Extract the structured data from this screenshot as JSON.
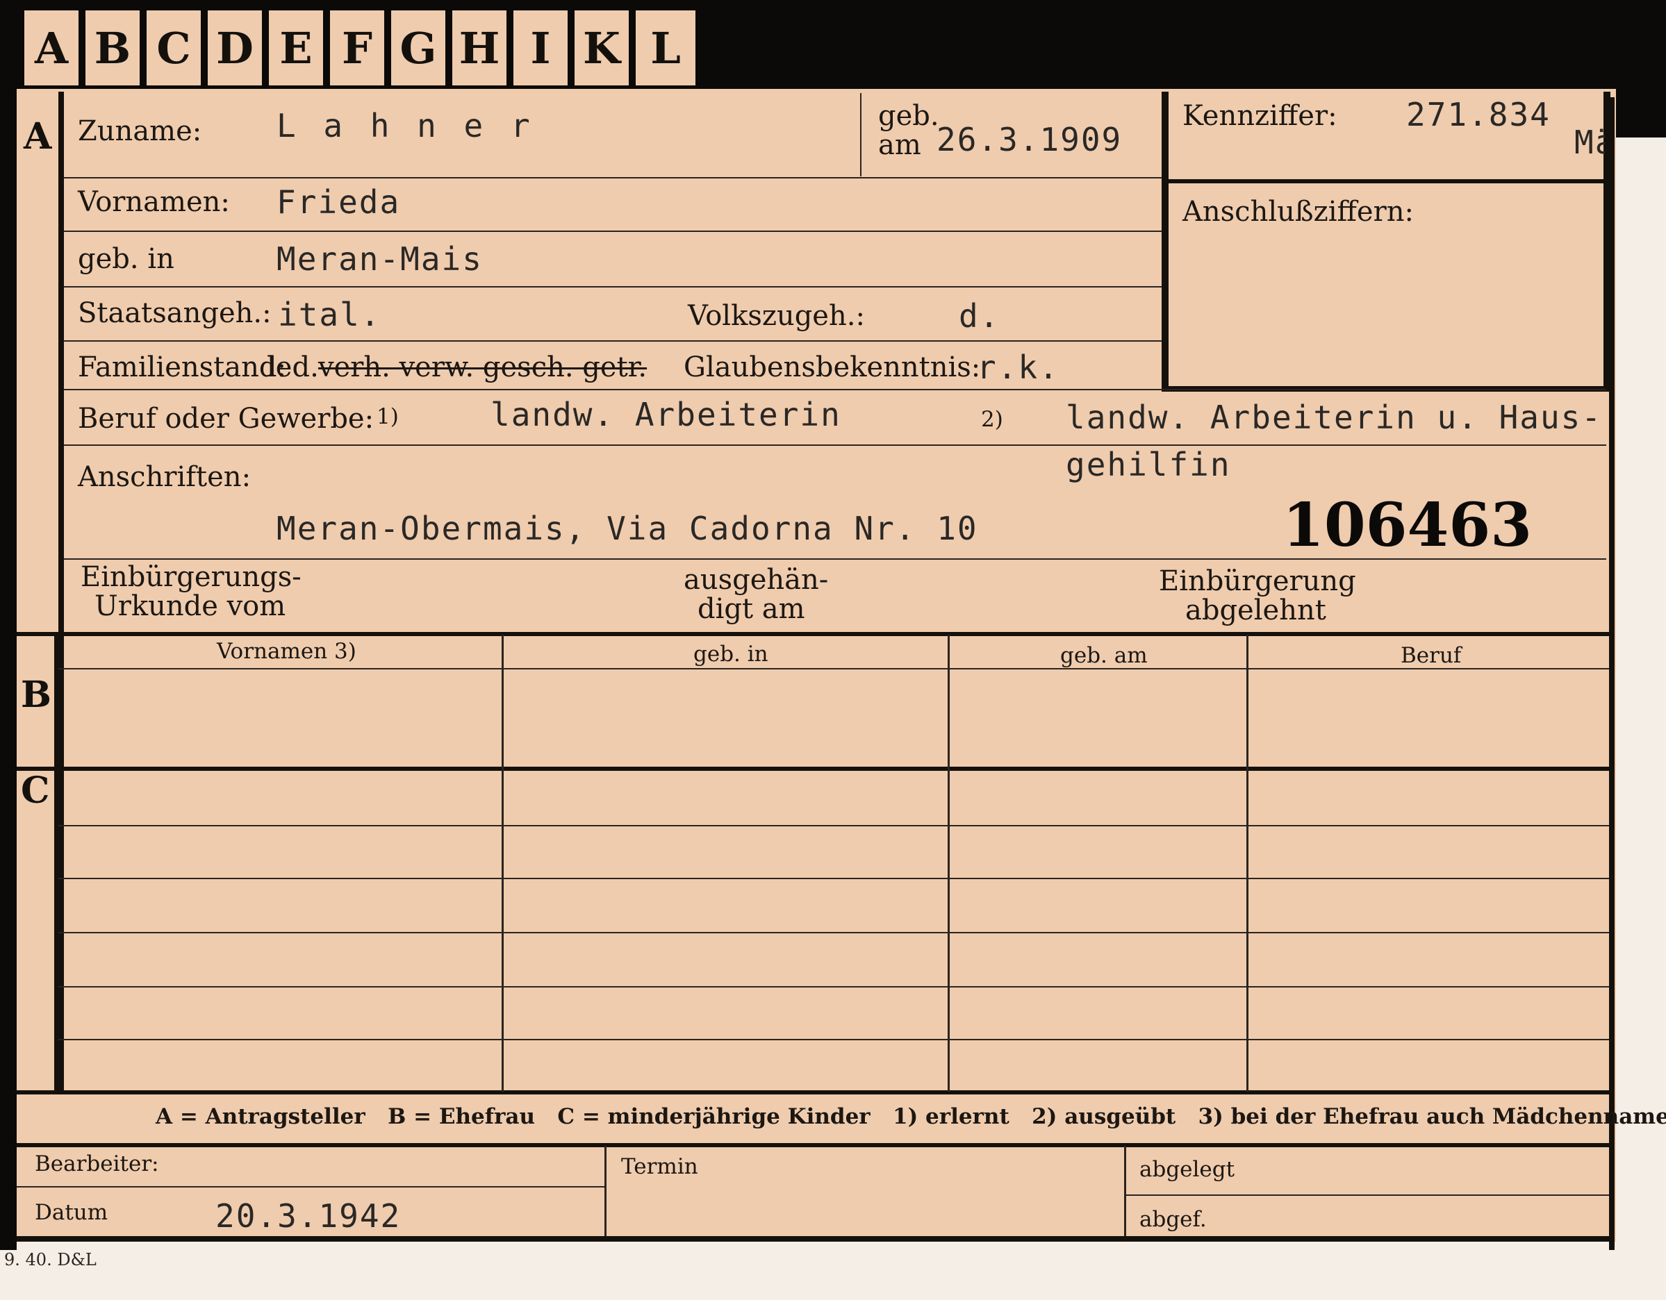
{
  "tabs": [
    "A",
    "B",
    "C",
    "D",
    "E",
    "F",
    "G",
    "H",
    "I",
    "K",
    "L"
  ],
  "sections": {
    "a": "A",
    "b": "B",
    "c": "C"
  },
  "person": {
    "surname_label": "Zuname:",
    "surname": "L a h n e r",
    "born_label_1": "geb.",
    "born_label_2": "am",
    "birth_date": "26.3.1909",
    "given_label": "Vornamen:",
    "given": "Frieda",
    "birthplace_label": "geb. in",
    "birthplace": "Meran-Mais",
    "citizenship_label": "Staatsangeh.:",
    "citizenship": "ital.",
    "ethnicity_label": "Volkszugeh.:",
    "ethnicity": "d.",
    "marital_label": "Familienstand:",
    "marital_selected": "led.",
    "marital_struck": "verh. verw. gesch. getr.",
    "religion_label": "Glaubensbekenntnis:",
    "religion": "r.k.",
    "occupation_label": "Beruf oder Gewerbe:",
    "occ_mark_1": "1)",
    "occupation_learned": "landw. Arbeiterin",
    "occ_mark_2": "2)",
    "occupation_practiced_1": "landw. Arbeiterin u. Haus-",
    "occupation_practiced_2": "gehilfin",
    "address_label": "Anschriften:",
    "address": "Meran-Obermais, Via Cadorna Nr. 10",
    "stamp_number": "106463"
  },
  "reference": {
    "code_label": "Kennziffer:",
    "code": "271.834",
    "code_suffix": "Mä",
    "linked_label": "Anschlußziffern:"
  },
  "naturalization": {
    "certificate_label_1": "Einbürgerungs-",
    "certificate_label_2": "Urkunde vom",
    "handed_label_1": "ausgehän-",
    "handed_label_2": "digt am",
    "refused_label_1": "Einbürgerung",
    "refused_label_2": "abgelehnt"
  },
  "wife_table": {
    "headers": [
      "Vornamen 3)",
      "geb. in",
      "geb. am",
      "Beruf"
    ]
  },
  "legend": "A = Antragsteller   B = Ehefrau   C = minderjährige Kinder   1) erlernt   2) ausgeübt   3) bei der Ehefrau auch Mädchenname",
  "footer": {
    "clerk_label": "Bearbeiter:",
    "date_label": "Datum",
    "date": "20.3.1942",
    "deadline_label": "Termin",
    "filed_label": "abgelegt",
    "sent_label": "abgef."
  },
  "print_code": "9. 40. D&L"
}
